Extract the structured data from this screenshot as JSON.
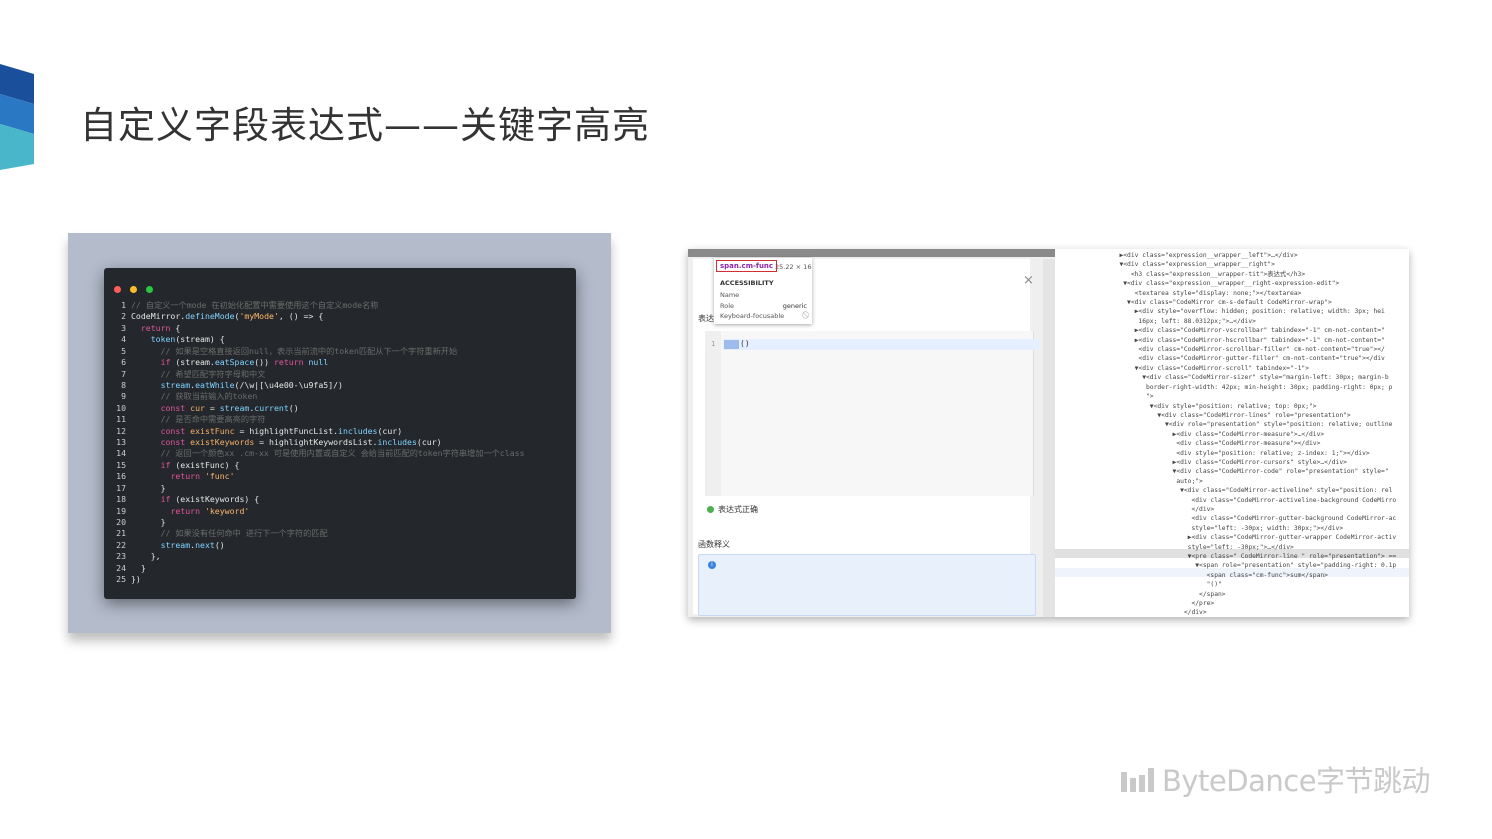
{
  "slide": {
    "title": "自定义字段表达式——关键字高亮",
    "accent_colors": [
      "#1a4f9c",
      "#2a78c4",
      "#4ab6c9"
    ]
  },
  "code_window": {
    "dot_colors": [
      "#ff5f56",
      "#ffbd2e",
      "#27c93f"
    ],
    "lines": [
      {
        "n": "1",
        "parts": [
          {
            "c": "cmt",
            "t": "// 自定义一个mode 在初始化配置中需要使用这个自定义mode名称"
          }
        ]
      },
      {
        "n": "2",
        "parts": [
          {
            "c": "",
            "t": "CodeMirror."
          },
          {
            "c": "fn",
            "t": "defineMode"
          },
          {
            "c": "",
            "t": "("
          },
          {
            "c": "str",
            "t": "'myMode'"
          },
          {
            "c": "",
            "t": ", () => {"
          }
        ]
      },
      {
        "n": "3",
        "parts": [
          {
            "c": "",
            "t": "  "
          },
          {
            "c": "kw",
            "t": "return"
          },
          {
            "c": "",
            "t": " {"
          }
        ]
      },
      {
        "n": "4",
        "parts": [
          {
            "c": "",
            "t": "    "
          },
          {
            "c": "fn",
            "t": "token"
          },
          {
            "c": "",
            "t": "(stream) {"
          }
        ]
      },
      {
        "n": "5",
        "parts": [
          {
            "c": "cmt",
            "t": "      // 如果是空格直接返回null，表示当前流中的token匹配从下一个字符重新开始"
          }
        ]
      },
      {
        "n": "6",
        "parts": [
          {
            "c": "",
            "t": "      "
          },
          {
            "c": "kw",
            "t": "if"
          },
          {
            "c": "",
            "t": " (stream."
          },
          {
            "c": "fn",
            "t": "eatSpace"
          },
          {
            "c": "",
            "t": "()) "
          },
          {
            "c": "kw",
            "t": "return"
          },
          {
            "c": "fn",
            "t": " null"
          }
        ]
      },
      {
        "n": "7",
        "parts": [
          {
            "c": "cmt",
            "t": "      // 希望匹配字符字母和中文"
          }
        ]
      },
      {
        "n": "8",
        "parts": [
          {
            "c": "",
            "t": "      "
          },
          {
            "c": "fn",
            "t": "stream"
          },
          {
            "c": "",
            "t": "."
          },
          {
            "c": "fn",
            "t": "eatWhile"
          },
          {
            "c": "",
            "t": "(/\\w|[\\u4e00-\\u9fa5]/)"
          }
        ]
      },
      {
        "n": "9",
        "parts": [
          {
            "c": "cmt",
            "t": "      // 获取当前输入的token"
          }
        ]
      },
      {
        "n": "10",
        "parts": [
          {
            "c": "",
            "t": "      "
          },
          {
            "c": "kw",
            "t": "const"
          },
          {
            "c": "var",
            "t": " cur"
          },
          {
            "c": "",
            "t": " = "
          },
          {
            "c": "fn",
            "t": "stream"
          },
          {
            "c": "",
            "t": "."
          },
          {
            "c": "fn",
            "t": "current"
          },
          {
            "c": "",
            "t": "()"
          }
        ]
      },
      {
        "n": "11",
        "parts": [
          {
            "c": "cmt",
            "t": "      // 是否命中需要高亮的字符"
          }
        ]
      },
      {
        "n": "12",
        "parts": [
          {
            "c": "",
            "t": "      "
          },
          {
            "c": "kw",
            "t": "const"
          },
          {
            "c": "var",
            "t": " existFunc"
          },
          {
            "c": "",
            "t": " = highlightFuncList."
          },
          {
            "c": "fn",
            "t": "includes"
          },
          {
            "c": "",
            "t": "(cur)"
          }
        ]
      },
      {
        "n": "13",
        "parts": [
          {
            "c": "",
            "t": "      "
          },
          {
            "c": "kw",
            "t": "const"
          },
          {
            "c": "var",
            "t": " existKeywords"
          },
          {
            "c": "",
            "t": " = highlightKeywordsList."
          },
          {
            "c": "fn",
            "t": "includes"
          },
          {
            "c": "",
            "t": "(cur)"
          }
        ]
      },
      {
        "n": "14",
        "parts": [
          {
            "c": "cmt",
            "t": "      // 返回一个颜色xx .cm-xx 可是使用内置或自定义 会给当前匹配的token字符串增加一个class"
          }
        ]
      },
      {
        "n": "15",
        "parts": [
          {
            "c": "",
            "t": "      "
          },
          {
            "c": "kw",
            "t": "if"
          },
          {
            "c": "",
            "t": " (existFunc) {"
          }
        ]
      },
      {
        "n": "16",
        "parts": [
          {
            "c": "",
            "t": "        "
          },
          {
            "c": "kw",
            "t": "return"
          },
          {
            "c": "str",
            "t": " 'func'"
          }
        ]
      },
      {
        "n": "17",
        "parts": [
          {
            "c": "",
            "t": "      }"
          }
        ]
      },
      {
        "n": "18",
        "parts": [
          {
            "c": "",
            "t": "      "
          },
          {
            "c": "kw",
            "t": "if"
          },
          {
            "c": "",
            "t": " (existKeywords) {"
          }
        ]
      },
      {
        "n": "19",
        "parts": [
          {
            "c": "",
            "t": "        "
          },
          {
            "c": "kw",
            "t": "return"
          },
          {
            "c": "str",
            "t": " 'keyword'"
          }
        ]
      },
      {
        "n": "20",
        "parts": [
          {
            "c": "",
            "t": "      }"
          }
        ]
      },
      {
        "n": "21",
        "parts": [
          {
            "c": "cmt",
            "t": "      // 如果没有任何命中 进行下一个字符的匹配"
          }
        ]
      },
      {
        "n": "22",
        "parts": [
          {
            "c": "",
            "t": "      "
          },
          {
            "c": "fn",
            "t": "stream"
          },
          {
            "c": "",
            "t": "."
          },
          {
            "c": "fn",
            "t": "next"
          },
          {
            "c": "",
            "t": "()"
          }
        ]
      },
      {
        "n": "23",
        "parts": [
          {
            "c": "",
            "t": "    },"
          }
        ]
      },
      {
        "n": "24",
        "parts": [
          {
            "c": "",
            "t": "  }"
          }
        ]
      },
      {
        "n": "25",
        "parts": [
          {
            "c": "",
            "t": "})"
          }
        ]
      }
    ]
  },
  "screenshot": {
    "expr_label": "表达式",
    "editor_line_no": "1",
    "editor_text": "()",
    "status_ok": "表达式正确",
    "func_label": "函数释义",
    "close_icon": "×",
    "info_icon": "i",
    "tooltip": {
      "tag": "span.cm-func",
      "size": "25.22 × 16",
      "section": "ACCESSIBILITY",
      "name_label": "Name",
      "role_label": "Role",
      "role_value": "generic",
      "focus_label": "Keyboard-focusable",
      "focus_icon": "⃠"
    },
    "dom_lines": [
      "                 ▶<div class=\"expression__wrapper__left\">…</div>",
      "                 ▼<div class=\"expression__wrapper__right\">",
      "                    <h3 class=\"expression__wrapper-tit\">表达式</h3>",
      "                  ▼<div class=\"expression__wrapper__right-expression-edit\">",
      "                     <textarea style=\"display: none;\"></textarea>",
      "                   ▼<div class=\"CodeMirror cm-s-default CodeMirror-wrap\">",
      "                     ▶<div style=\"overflow: hidden; position: relative; width: 3px; hei",
      "                      16px; left: 88.0312px;\">…</div>",
      "                     ▶<div class=\"CodeMirror-vscrollbar\" tabindex=\"-1\" cm-not-content=\"",
      "                     ▶<div class=\"CodeMirror-hscrollbar\" tabindex=\"-1\" cm-not-content=\"",
      "                      <div class=\"CodeMirror-scrollbar-filler\" cm-not-content=\"true\"></",
      "                      <div class=\"CodeMirror-gutter-filler\" cm-not-content=\"true\"></div",
      "                     ▼<div class=\"CodeMirror-scroll\" tabindex=\"-1\">",
      "                       ▼<div class=\"CodeMirror-sizer\" style=\"margin-left: 30px; margin-b",
      "                        border-right-width: 42px; min-height: 30px; padding-right: 0px; p",
      "                        \">",
      "                         ▼<div style=\"position: relative; top: 0px;\">",
      "                           ▼<div class=\"CodeMirror-lines\" role=\"presentation\">",
      "                             ▼<div role=\"presentation\" style=\"position: relative; outline",
      "                               ▶<div class=\"CodeMirror-measure\">…</div>",
      "                                <div class=\"CodeMirror-measure\"></div>",
      "                                <div style=\"position: relative; z-index: 1;\"></div>",
      "                               ▶<div class=\"CodeMirror-cursors\" style>…</div>",
      "                               ▼<div class=\"CodeMirror-code\" role=\"presentation\" style=\"",
      "                                auto;\">",
      "                                 ▼<div class=\"CodeMirror-activeline\" style=\"position: rel",
      "                                    <div class=\"CodeMirror-activeline-background CodeMirro",
      "                                    </div>",
      "                                    <div class=\"CodeMirror-gutter-background CodeMirror-ac",
      "                                    style=\"left: -30px; width: 30px;\"></div>",
      "                                   ▶<div class=\"CodeMirror-gutter-wrapper CodeMirror-activ",
      "                                   style=\"left: -30px;\">…</div>",
      "                                   ▼<pre class=\" CodeMirror-line \" role=\"presentation\"> ==",
      "                                     ▼<span role=\"presentation\" style=\"padding-right: 0.1p",
      "                                        <span class=\"cm-func\">sum</span>",
      "                                        \"()\"",
      "                                      </span>",
      "                                    </pre>",
      "                                  </div>"
    ]
  },
  "logo": {
    "text": "ByteDance字节跳动",
    "color": "#c9c9c9"
  }
}
